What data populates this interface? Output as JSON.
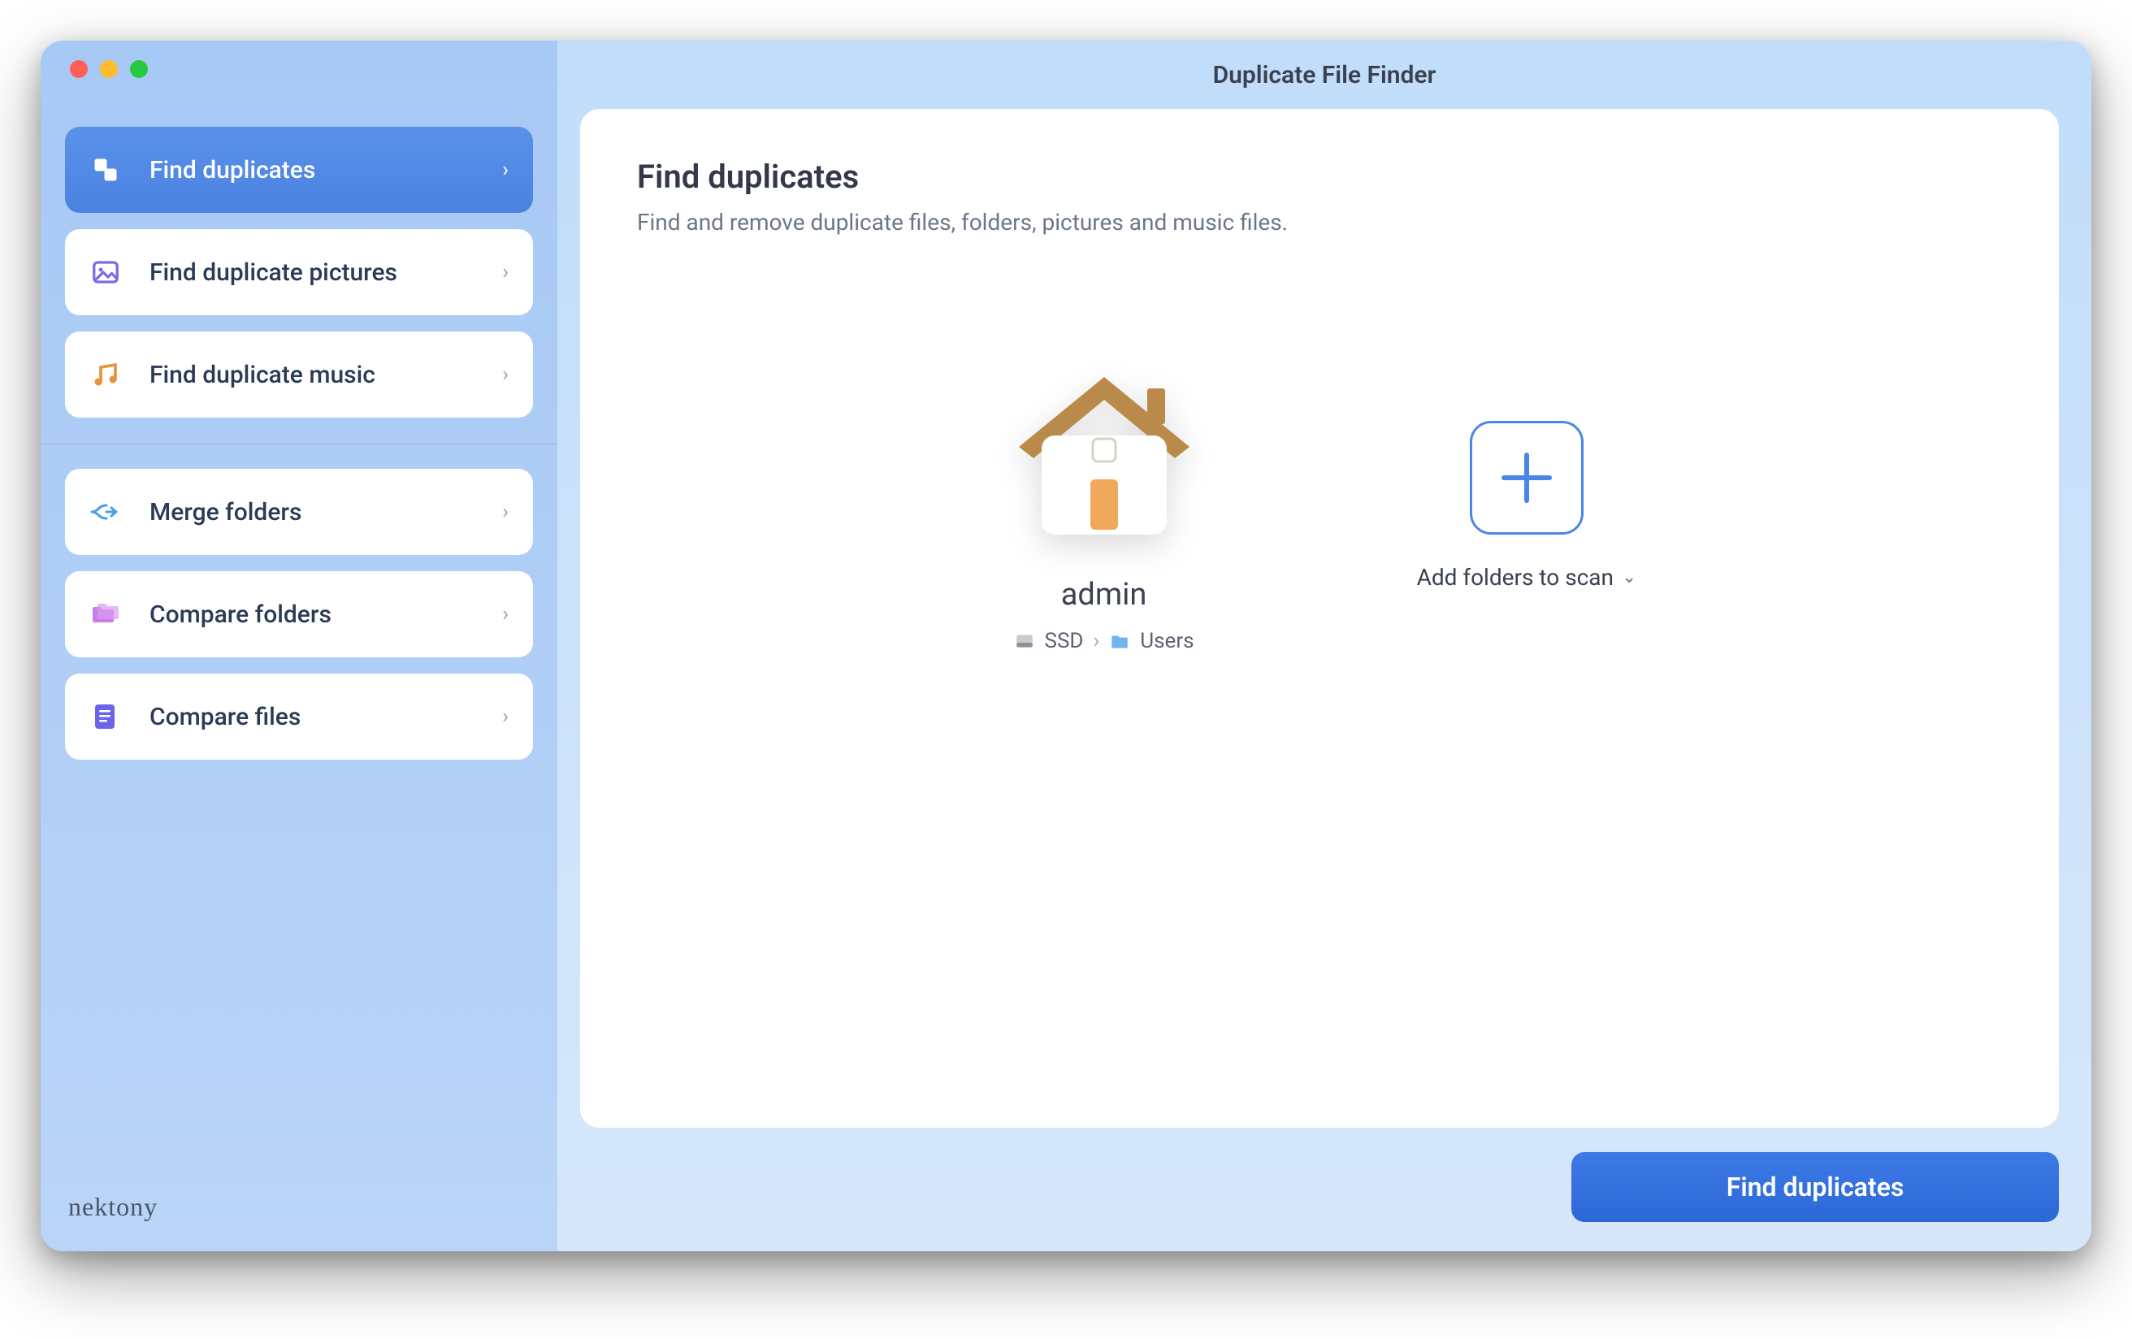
{
  "titlebar": {
    "title": "Duplicate File Finder"
  },
  "sidebar": {
    "items": [
      {
        "label": "Find duplicates",
        "icon": "duplicates"
      },
      {
        "label": "Find duplicate pictures",
        "icon": "pictures"
      },
      {
        "label": "Find duplicate music",
        "icon": "music"
      },
      {
        "label": "Merge folders",
        "icon": "merge"
      },
      {
        "label": "Compare folders",
        "icon": "compare-folders"
      },
      {
        "label": "Compare files",
        "icon": "compare-files"
      }
    ],
    "brand": "nektony"
  },
  "main": {
    "heading": "Find duplicates",
    "subheading": "Find and remove duplicate files, folders, pictures and music files.",
    "folder": {
      "name": "admin",
      "path": [
        {
          "icon": "disk",
          "label": "SSD"
        },
        {
          "icon": "folder",
          "label": "Users"
        }
      ]
    },
    "add": {
      "label": "Add folders to scan"
    },
    "action": {
      "label": "Find duplicates"
    }
  }
}
